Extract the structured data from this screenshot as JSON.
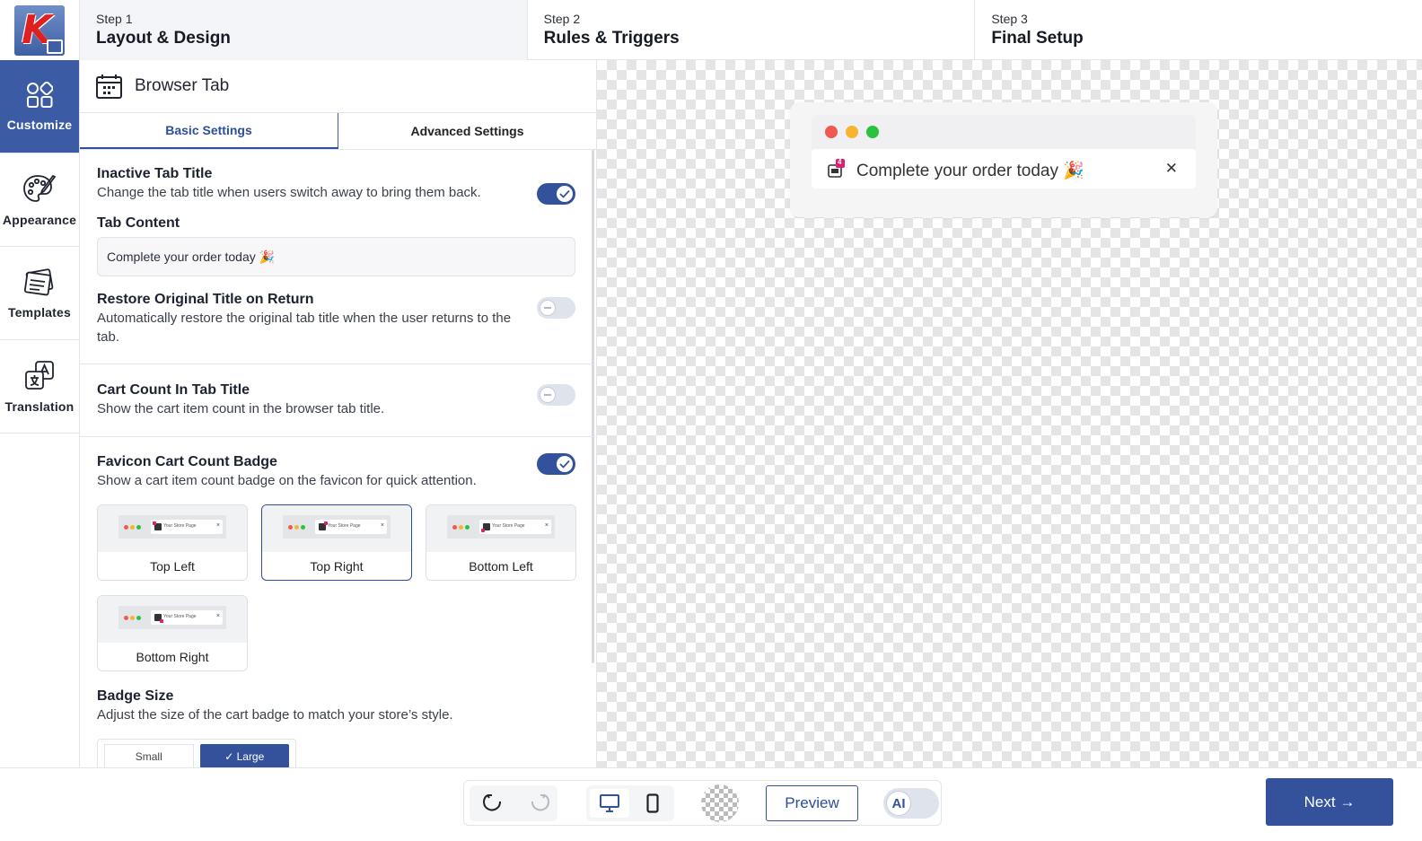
{
  "steps": [
    {
      "num": "Step 1",
      "title": "Layout & Design"
    },
    {
      "num": "Step 2",
      "title": "Rules & Triggers"
    },
    {
      "num": "Step 3",
      "title": "Final Setup"
    }
  ],
  "logo": {
    "letter": "K"
  },
  "rail": [
    {
      "label": "Customize",
      "icon": "grid-shapes-icon",
      "active": true
    },
    {
      "label": "Appearance",
      "icon": "palette-icon",
      "active": false
    },
    {
      "label": "Templates",
      "icon": "templates-icon",
      "active": false
    },
    {
      "label": "Translation",
      "icon": "translate-icon",
      "active": false
    }
  ],
  "panel": {
    "title": "Browser Tab",
    "tabs": [
      {
        "label": "Basic Settings",
        "active": true
      },
      {
        "label": "Advanced Settings",
        "active": false
      }
    ],
    "inactive_tab": {
      "heading": "Inactive Tab Title",
      "desc": "Change the tab title when users switch away to bring them back.",
      "enabled": true
    },
    "tab_content": {
      "label": "Tab Content",
      "value": "Complete your order today 🎉"
    },
    "restore": {
      "heading": "Restore Original Title on Return",
      "desc": "Automatically restore the original tab title when the user returns to the tab.",
      "enabled": false
    },
    "cart_count": {
      "heading": "Cart Count In Tab Title",
      "desc": "Show the cart item count in the browser tab title.",
      "enabled": false
    },
    "favicon_badge": {
      "heading": "Favicon Cart Count Badge",
      "desc": "Show a cart item count badge on the favicon for quick attention.",
      "enabled": true
    },
    "positions": [
      {
        "label": "Top Left",
        "selected": false,
        "thumb_text": "Your Store Page"
      },
      {
        "label": "Top Right",
        "selected": true,
        "thumb_text": "Your Store Page"
      },
      {
        "label": "Bottom Left",
        "selected": false,
        "thumb_text": "Your Store Page"
      },
      {
        "label": "Bottom Right",
        "selected": false,
        "thumb_text": "Your Store Page"
      }
    ],
    "badge_size": {
      "heading": "Badge Size",
      "desc": "Adjust the size of the cart badge to match your store’s style.",
      "options": [
        "Small",
        "✓ Large"
      ],
      "selected": "Large"
    }
  },
  "preview": {
    "tab_title": "Complete your order today 🎉",
    "badge_count": "4",
    "close_glyph": "✕"
  },
  "bottom": {
    "preview_label": "Preview",
    "ai_label": "AI",
    "next_label": "Next →"
  },
  "colors": {
    "primary": "#34529c",
    "traffic_red": "#ee5a52",
    "traffic_yellow": "#f6b431",
    "traffic_green": "#2ac341",
    "badge_pink": "#e21d6e"
  }
}
